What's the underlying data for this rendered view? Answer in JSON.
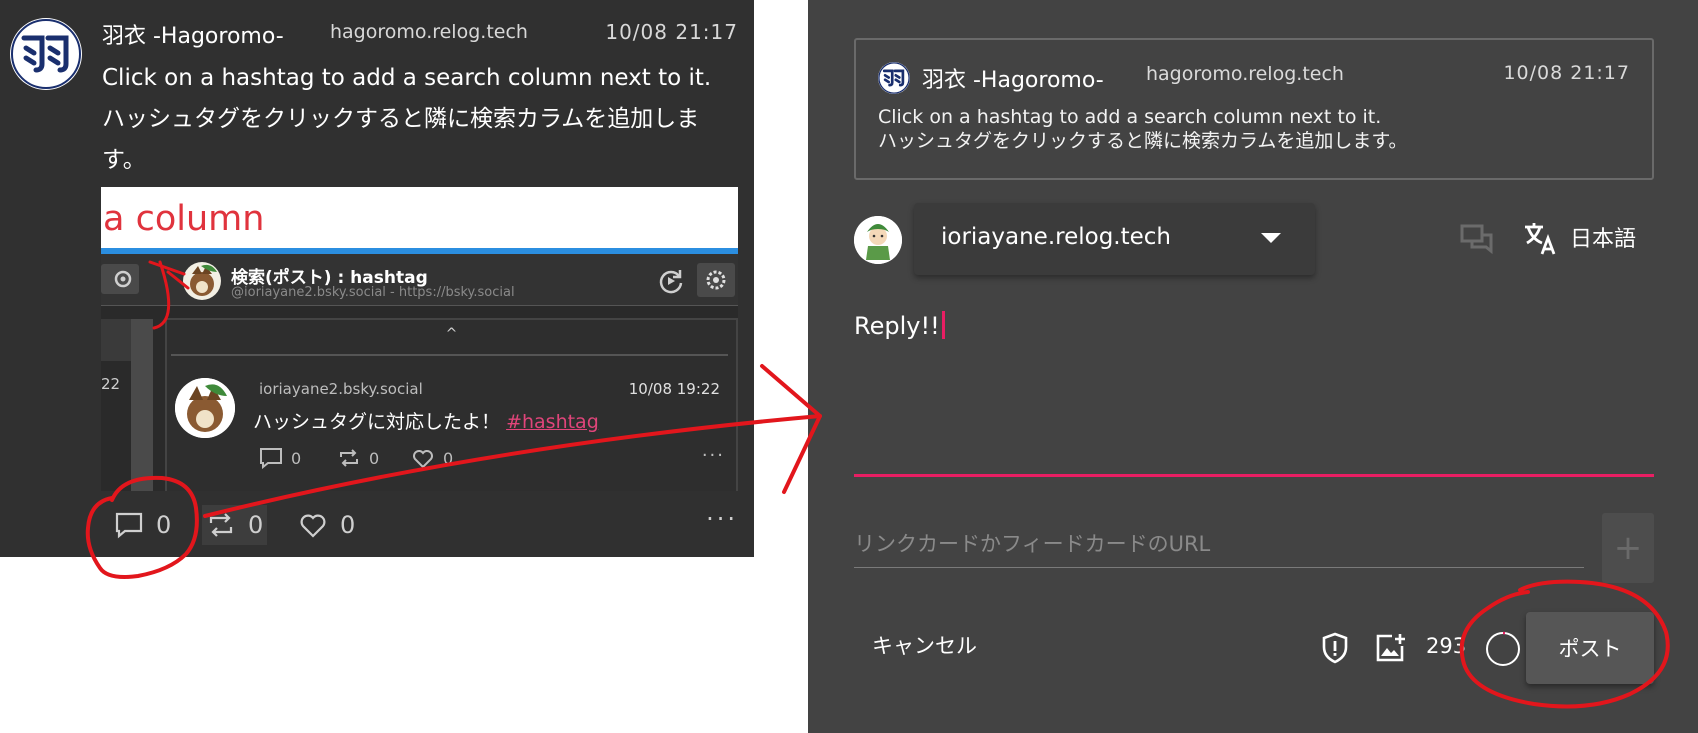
{
  "post": {
    "author_name": "羽衣 -Hagoromo-",
    "handle": "hagoromo.relog.tech",
    "time": "10/08 21:17",
    "text_en": "Click on a hashtag to add a search column next to it.",
    "text_ja": "ハッシュタグをクリックすると隣に検索カラムを追加します。",
    "embed": {
      "banner_text": "a column",
      "column_title": "検索(ポスト) : hashtag",
      "column_subtitle": "@ioriayane2.bsky.social - https://bsky.social",
      "side_number": "22",
      "caret": "^",
      "reply_handle": "ioriayane2.bsky.social",
      "reply_time": "10/08 19:22",
      "reply_text": "ハッシュタグに対応したよ！",
      "reply_hashtag": "#hashtag",
      "reply_count": "0",
      "repost_count": "0",
      "like_count": "0",
      "more": "···"
    },
    "actions": {
      "reply_count": "0",
      "repost_count": "0",
      "like_count": "0",
      "more": "···"
    }
  },
  "composer": {
    "quote": {
      "author_name": "羽衣 -Hagoromo-",
      "handle": "hagoromo.relog.tech",
      "time": "10/08 21:17",
      "text_en": "Click on a hashtag to add a search column next to it.",
      "text_ja": "ハッシュタグをクリックすると隣に検索カラムを追加します。"
    },
    "account": "ioriayane.relog.tech",
    "language": "日本語",
    "reply_text": "Reply!!",
    "url_placeholder": "リンクカードかフィードカードのURL",
    "url_add": "+",
    "cancel_label": "キャンセル",
    "remaining_chars": "293",
    "post_label": "ポスト"
  },
  "colors": {
    "accent": "#e91e63",
    "annotation": "#e2161c",
    "banner_text": "#e0333d"
  },
  "icons": [
    "avatar-hagoromo-icon",
    "gear-icon",
    "refresh-icon",
    "reply-icon",
    "repost-icon",
    "like-icon",
    "chevron-down-icon",
    "threadgate-icon",
    "translate-icon",
    "shield-icon",
    "image-add-icon",
    "progress-ring-icon"
  ]
}
